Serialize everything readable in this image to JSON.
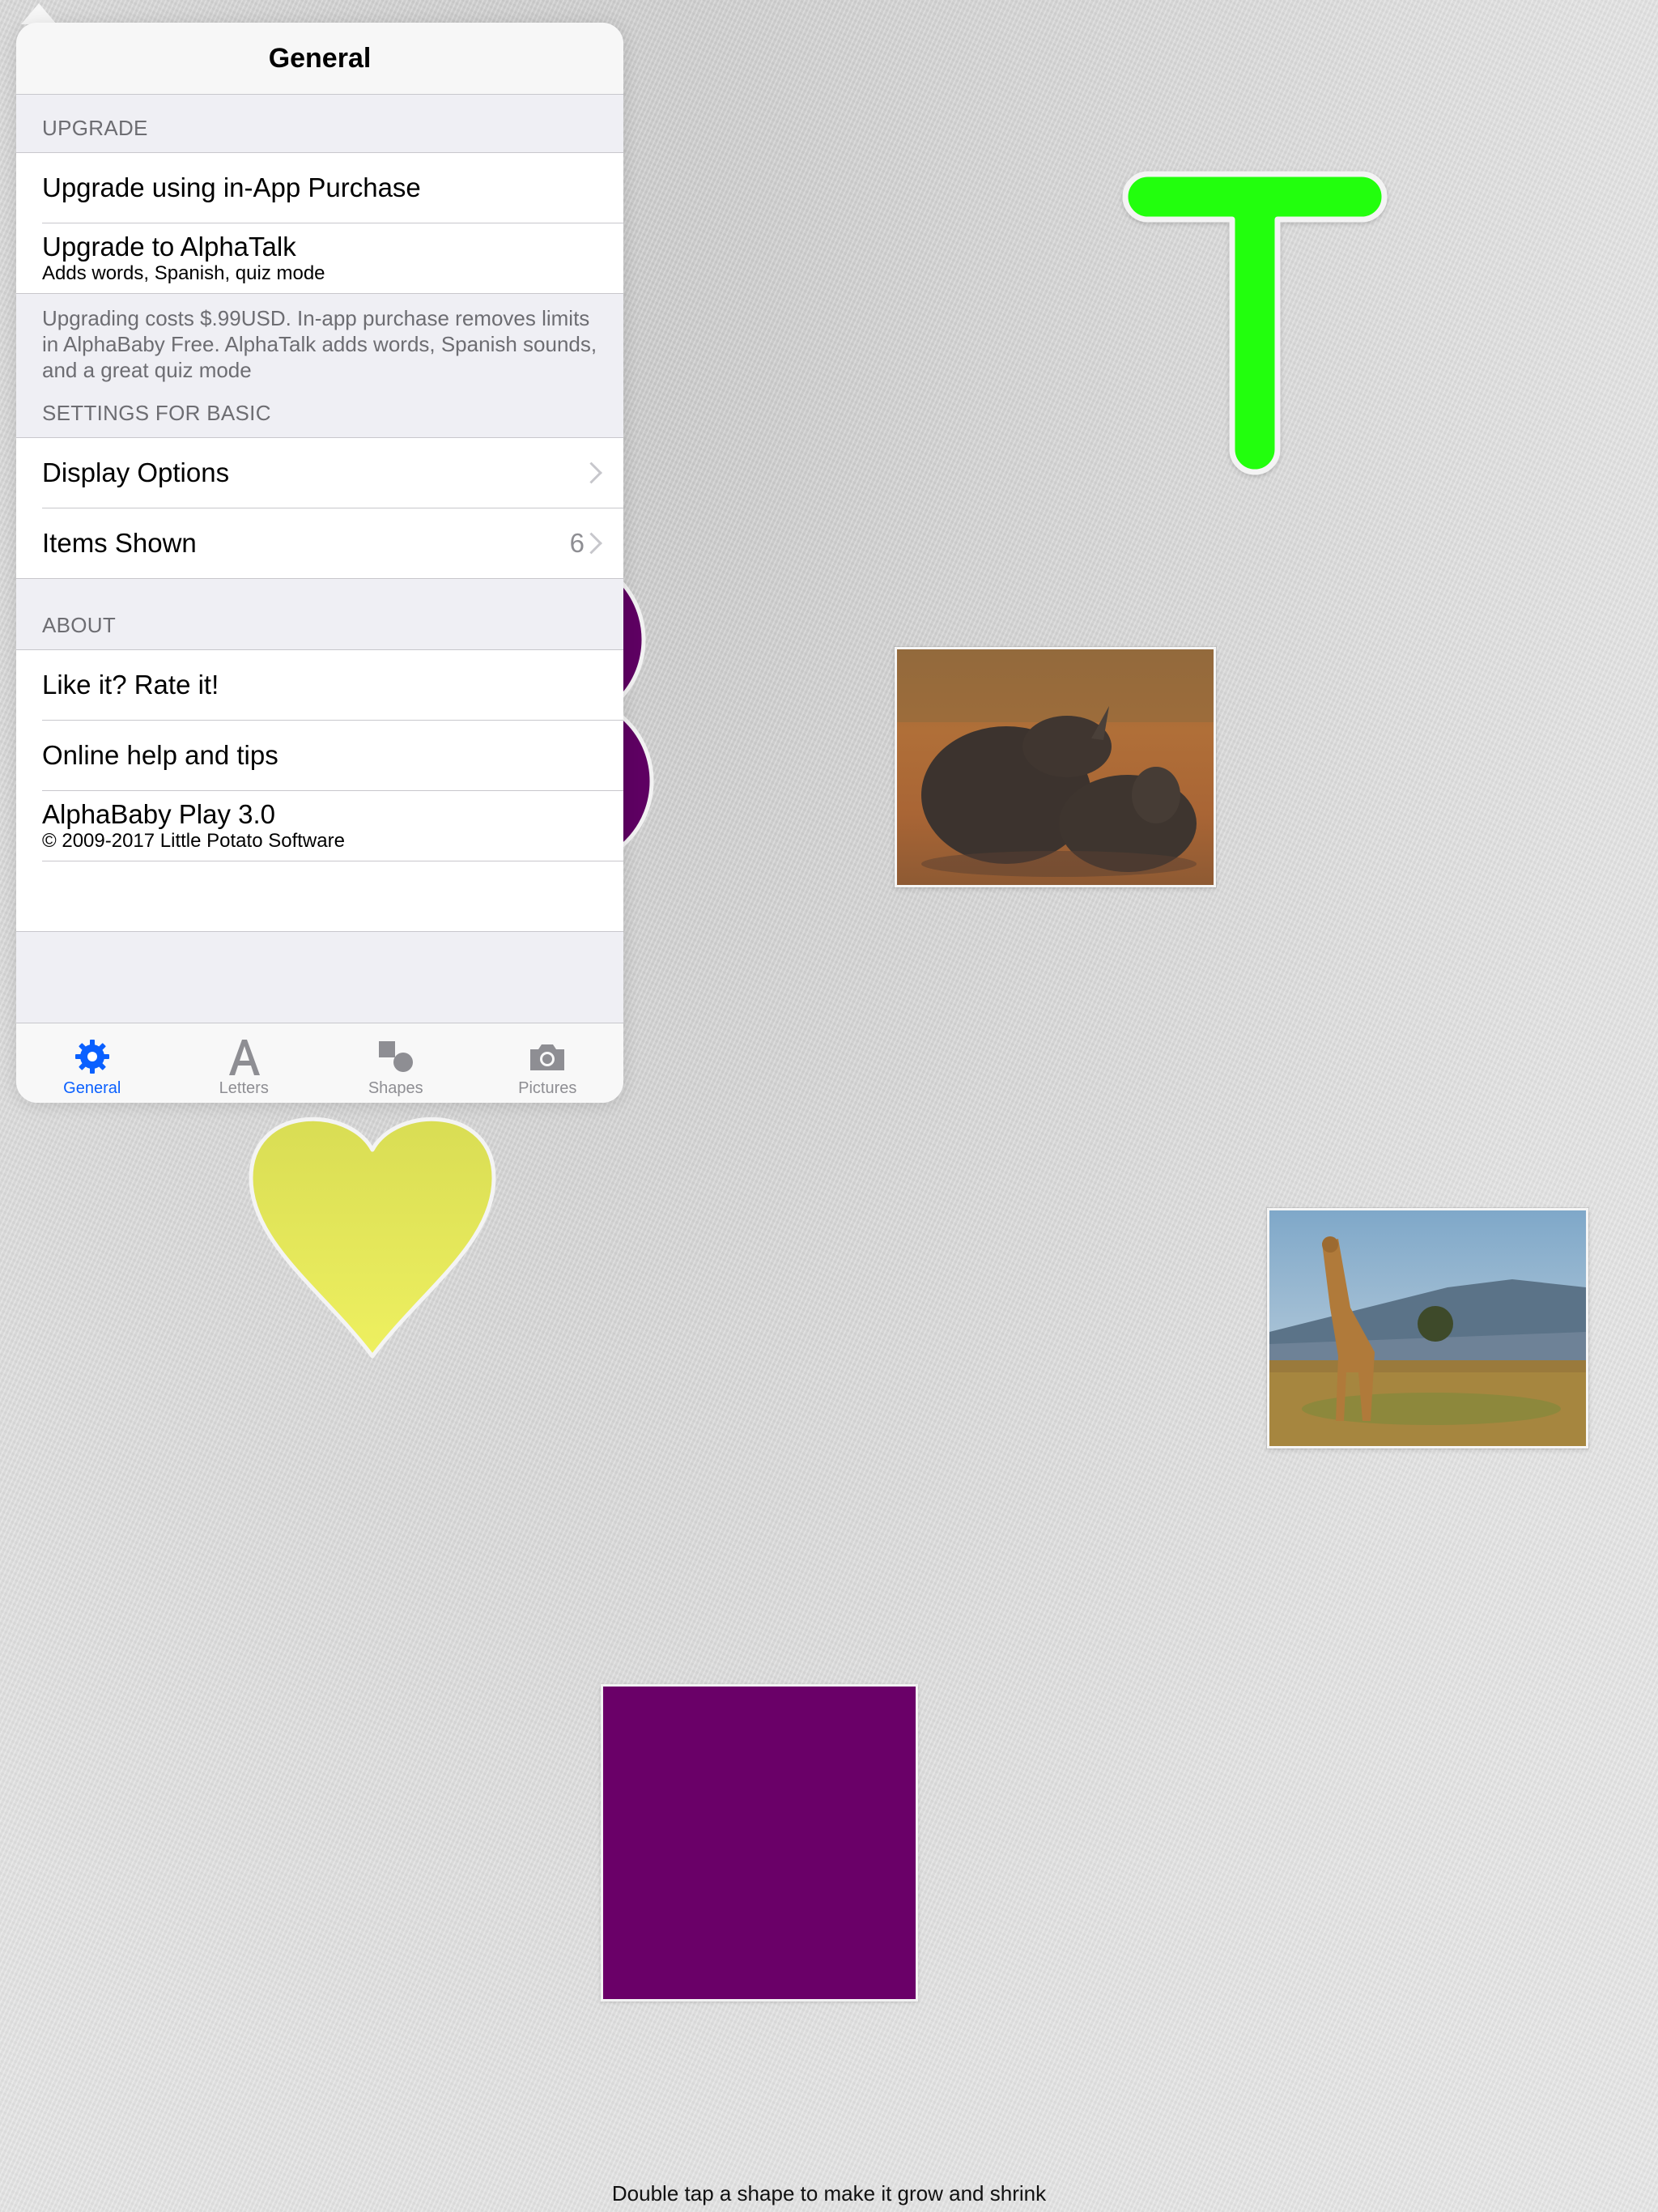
{
  "popover": {
    "title": "General",
    "sections": {
      "upgrade": {
        "header": "UPGRADE",
        "items": [
          {
            "label": "Upgrade using in-App Purchase"
          },
          {
            "label": "Upgrade to AlphaTalk",
            "subtitle": "Adds words, Spanish, quiz mode"
          }
        ],
        "footer": "Upgrading costs $.99USD.   In-app purchase removes limits in AlphaBaby Free.  AlphaTalk adds words, Spanish sounds, and a great quiz mode"
      },
      "settings": {
        "header": "SETTINGS FOR BASIC",
        "items": [
          {
            "label": "Display Options"
          },
          {
            "label": "Items Shown",
            "value": "6"
          }
        ]
      },
      "about": {
        "header": "ABOUT",
        "items": [
          {
            "label": "Like it? Rate it!"
          },
          {
            "label": "Online help and tips"
          },
          {
            "label": "AlphaBaby Play 3.0",
            "subtitle": "© 2009-2017 Little Potato Software"
          }
        ]
      }
    },
    "tabs": [
      {
        "label": "General",
        "icon": "gear-icon",
        "active": true
      },
      {
        "label": "Letters",
        "icon": "letter-a-icon",
        "active": false
      },
      {
        "label": "Shapes",
        "icon": "shapes-icon",
        "active": false
      },
      {
        "label": "Pictures",
        "icon": "camera-icon",
        "active": false
      }
    ]
  },
  "canvas": {
    "letter": "T",
    "colors": {
      "letter": "#22ff0b",
      "heart": "#e8ec52",
      "square": "#6a0068",
      "circles": "#5e0062",
      "accent": "#0a60ff"
    },
    "hint": "Double tap a shape to make it grow and shrink"
  }
}
